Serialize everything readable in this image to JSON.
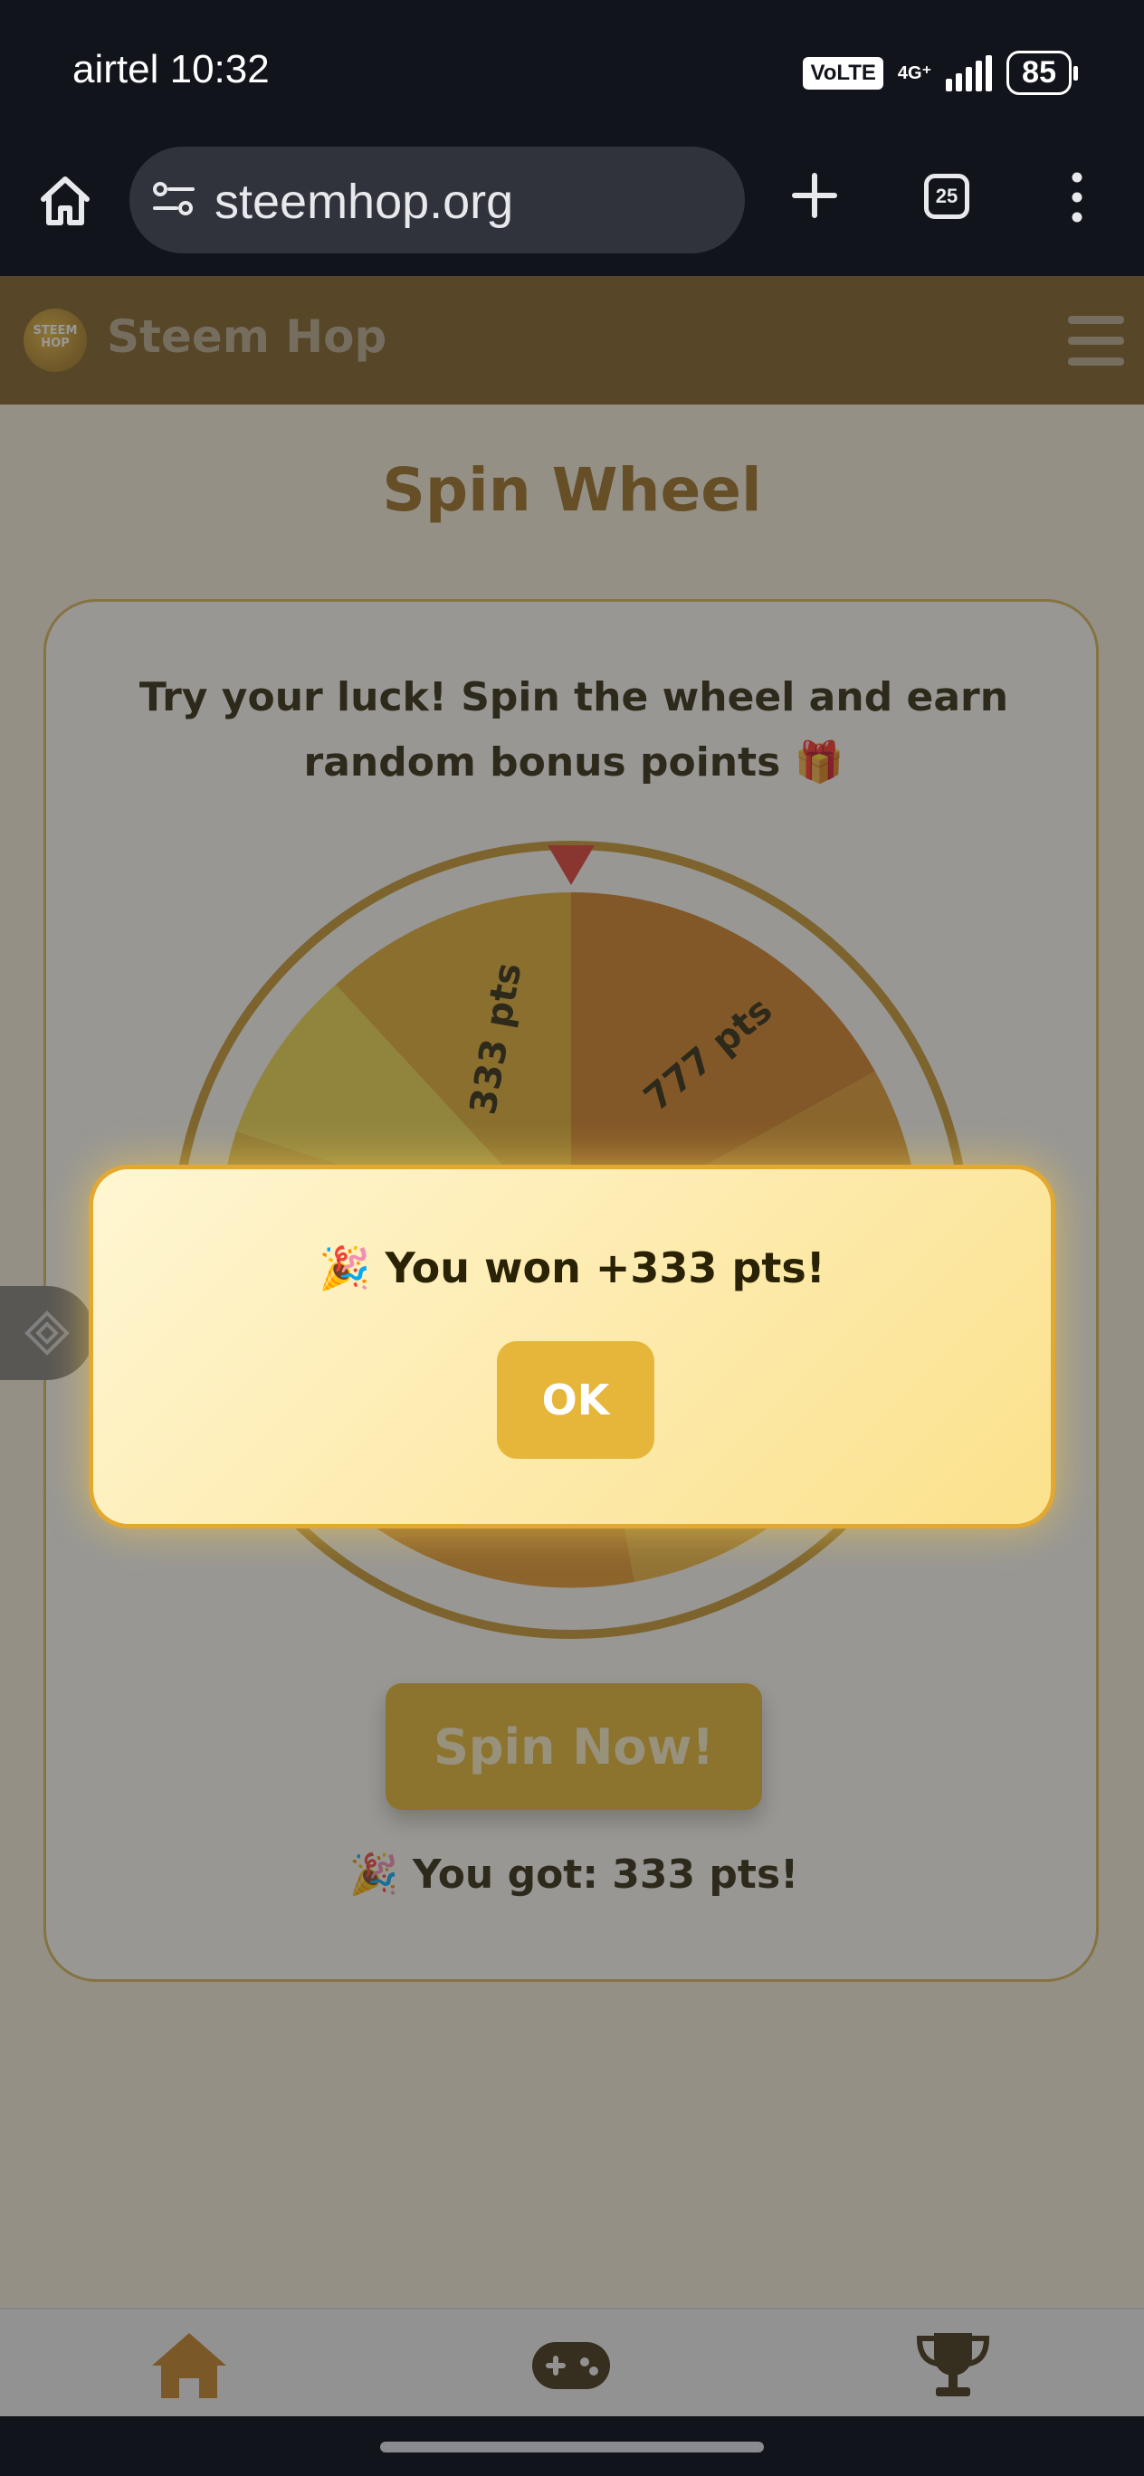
{
  "status_bar": {
    "carrier_time": "airtel 10:32",
    "volte": "VoLTE",
    "network": "4G⁺",
    "battery": "85"
  },
  "browser": {
    "url": "steemhop.org",
    "tab_count": "25"
  },
  "header": {
    "brand": "Steem Hop",
    "logo_text": "STEEM HOP"
  },
  "page": {
    "title": "Spin Wheel",
    "intro": "Try your luck! Spin the wheel and earn random bonus points 🎁",
    "spin_button": "Spin Now!",
    "result": "🎉 You got: 333 pts!"
  },
  "wheel": {
    "visible_labels": [
      "333 pts",
      "777 pts"
    ]
  },
  "dialog": {
    "message": "🎉 You won +333 pts!",
    "ok_label": "OK"
  },
  "colors": {
    "header_bg": "#7d5a1c",
    "accent": "#e6b63b",
    "title": "#9a6b1c"
  }
}
